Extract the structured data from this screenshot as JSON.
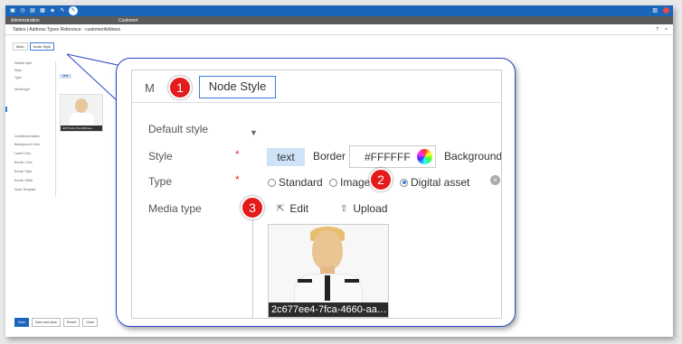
{
  "topbar": {
    "icons": [
      "home-icon",
      "clock-icon",
      "document-icon",
      "grid-icon",
      "puzzle-icon",
      "pin-icon",
      "pencil-icon"
    ]
  },
  "nav": {
    "admin": "Administration",
    "customer": "Customer"
  },
  "breadcrumb": {
    "text": "Tables  |  Address Types Reference - customerAddress",
    "help": "?",
    "close": "×"
  },
  "tabs": {
    "main": "Main",
    "node_style": "Node Style"
  },
  "small_form": {
    "labels": [
      "Default style",
      "Style",
      "Type",
      "Media type",
      "Conditional states",
      "Background Color",
      "Label Color",
      "Border Color",
      "Border Style",
      "Border Width",
      "Node Template"
    ],
    "chip": "text",
    "caption": "2c677ee4-7fca-4660-aa..."
  },
  "buttons": {
    "save": "Save",
    "save_close": "Save and close",
    "revert": "Revert",
    "close": "Close"
  },
  "zoom": {
    "tab_main": "M",
    "tab_node": "Node Style",
    "default_style": "Default style",
    "style_label": "Style",
    "type_label": "Type",
    "media_label": "Media type",
    "star": "*",
    "chip_text": "text",
    "border_label": "Border",
    "color_value": "#FFFFFF",
    "background_label": "Background",
    "radio_standard": "Standard",
    "radio_image": "Image",
    "radio_digital": "Digital asset",
    "edit": "Edit",
    "upload": "Upload",
    "caption": "2c677ee4-7fca-4660-aa…"
  },
  "markers": [
    "1",
    "2",
    "3"
  ]
}
